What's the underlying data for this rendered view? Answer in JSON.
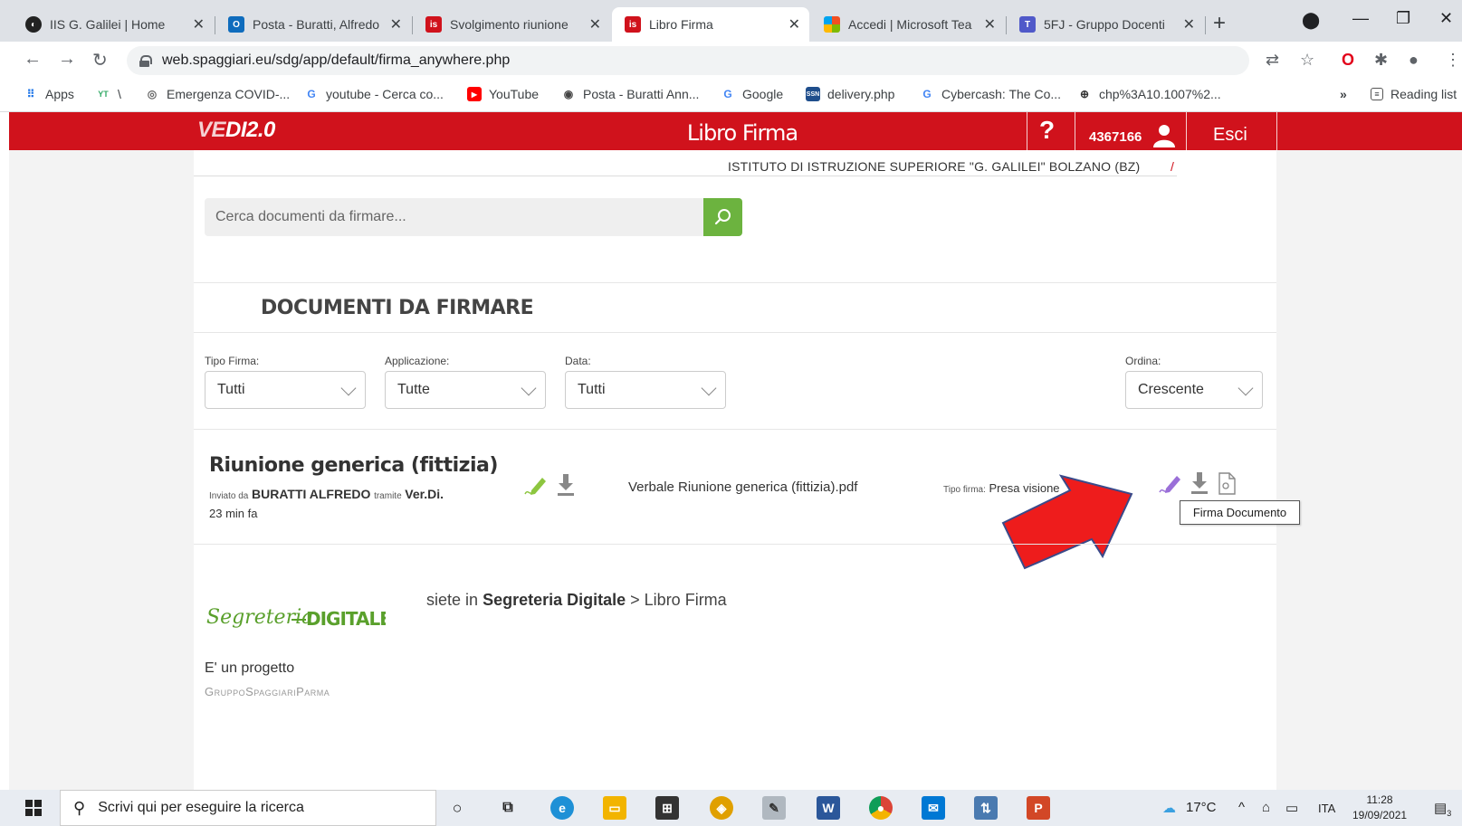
{
  "browser": {
    "tabs": [
      {
        "title": "IIS G. Galilei | Home",
        "icon": "galilei-icon"
      },
      {
        "title": "Posta - Buratti, Alfredo",
        "icon": "outlook-icon"
      },
      {
        "title": "Svolgimento riunione",
        "icon": "spaggiari-icon"
      },
      {
        "title": "Libro Firma",
        "icon": "spaggiari-icon"
      },
      {
        "title": "Accedi | Microsoft Tea",
        "icon": "microsoft-icon"
      },
      {
        "title": "5FJ - Gruppo Docenti",
        "icon": "teams-icon"
      }
    ],
    "url": "web.spaggiari.eu/sdg/app/default/firma_anywhere.php",
    "bookmarks": [
      {
        "label": "Apps"
      },
      {
        "label": "\\"
      },
      {
        "label": "Emergenza COVID-..."
      },
      {
        "label": "youtube - Cerca co..."
      },
      {
        "label": "YouTube"
      },
      {
        "label": "Posta - Buratti Ann..."
      },
      {
        "label": "Google"
      },
      {
        "label": "delivery.php"
      },
      {
        "label": "Cybercash: The Co..."
      },
      {
        "label": "chp%3A10.1007%2..."
      }
    ],
    "more_bookmarks": "»",
    "reading_list": "Reading list"
  },
  "header": {
    "logo_main": "VE",
    "logo_rest": "DI2.0",
    "title": "Libro Firma",
    "help": "?",
    "user_id": "4367166",
    "logout": "Esci",
    "brand_color": "#d0121c"
  },
  "school": {
    "name": "ISTITUTO DI ISTRUZIONE SUPERIORE \"G. GALILEI\"  BOLZANO (BZ)",
    "trailing": "/"
  },
  "search": {
    "placeholder": "Cerca documenti da firmare..."
  },
  "section": {
    "title": "DOCUMENTI DA FIRMARE"
  },
  "filters": [
    {
      "label": "Tipo Firma:",
      "value": "Tutti"
    },
    {
      "label": "Applicazione:",
      "value": "Tutte"
    },
    {
      "label": "Data:",
      "value": "Tutti"
    },
    {
      "label": "Ordina:",
      "value": "Crescente"
    }
  ],
  "document": {
    "title": "Riunione generica (fittizia)",
    "sent_by_label": "Inviato da",
    "sender": "BURATTI ALFREDO",
    "via_label": "tramite",
    "app": "Ver.Di.",
    "time_ago": "23 min fa",
    "filename": "Verbale Riunione generica (fittizia).pdf",
    "sign_type_label": "Tipo firma:",
    "sign_type": "Presa visione",
    "tooltip": "Firma Documento"
  },
  "footer": {
    "logo_script": "Segreteria",
    "logo_bold": "DIGITALE",
    "breadcrumb_prefix": "siete in",
    "breadcrumb_root": "Segreteria Digitale",
    "breadcrumb_sep": ">",
    "breadcrumb_current": "Libro Firma",
    "project_label": "E' un progetto",
    "company": "GruppoSpaggiariParma"
  },
  "taskbar": {
    "search_placeholder": "Scrivi qui per eseguire la ricerca",
    "temperature": "17°C",
    "language": "ITA",
    "time": "11:28",
    "date": "19/09/2021",
    "notifications": "3"
  }
}
